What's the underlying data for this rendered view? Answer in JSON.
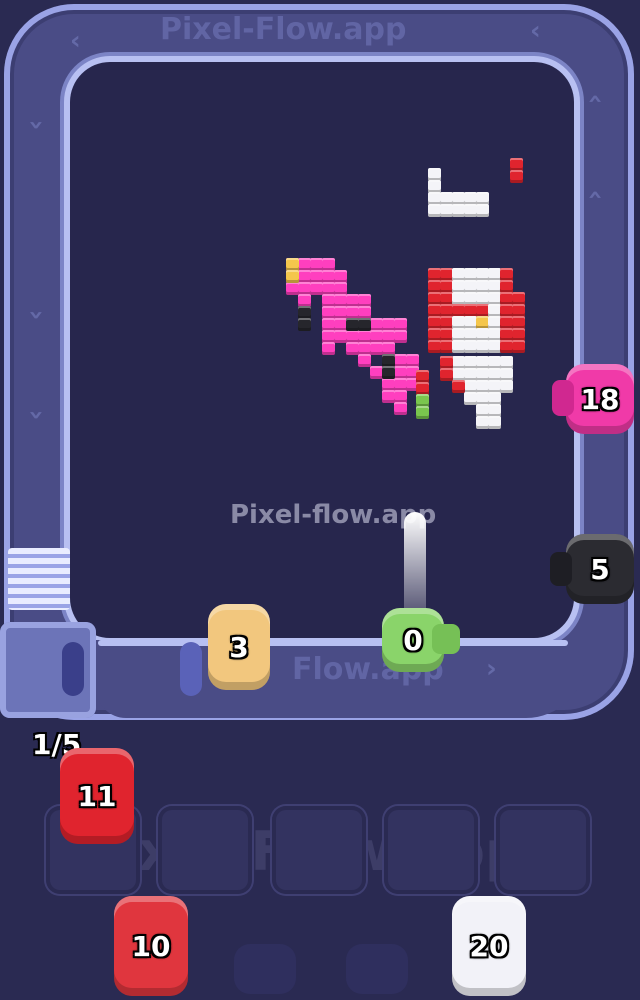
{
  "watermark": "Pixel-flow.app",
  "track_watermark_top": "Pixel-Flow.app",
  "track_watermark_bottom": "Flow.app",
  "slot_watermark": "Pixel-Flow.app",
  "queue_counter": "1/5",
  "shooters_on_track": [
    {
      "name": "pink",
      "value": "18",
      "color": "#f03aa8"
    },
    {
      "name": "black",
      "value": "5",
      "color": "#2b2b31"
    },
    {
      "name": "green",
      "value": "0",
      "color": "#8ad46a"
    },
    {
      "name": "tan",
      "value": "3",
      "color": "#f2c77e"
    }
  ],
  "queue": [
    {
      "name": "red-front",
      "value": "11",
      "color": "#e0242e"
    },
    {
      "name": "red-back",
      "value": "10",
      "color": "#e0363e"
    },
    {
      "name": "white",
      "value": "20",
      "color": "#f2f2f8"
    }
  ],
  "slots": [
    "",
    "",
    "",
    "",
    ""
  ],
  "palette": {
    "magenta": "#ff3fbf",
    "red": "#e0242e",
    "white": "#f4f4f8",
    "black": "#26262c",
    "yellow": "#f4c64c",
    "green": "#7ac64e"
  }
}
